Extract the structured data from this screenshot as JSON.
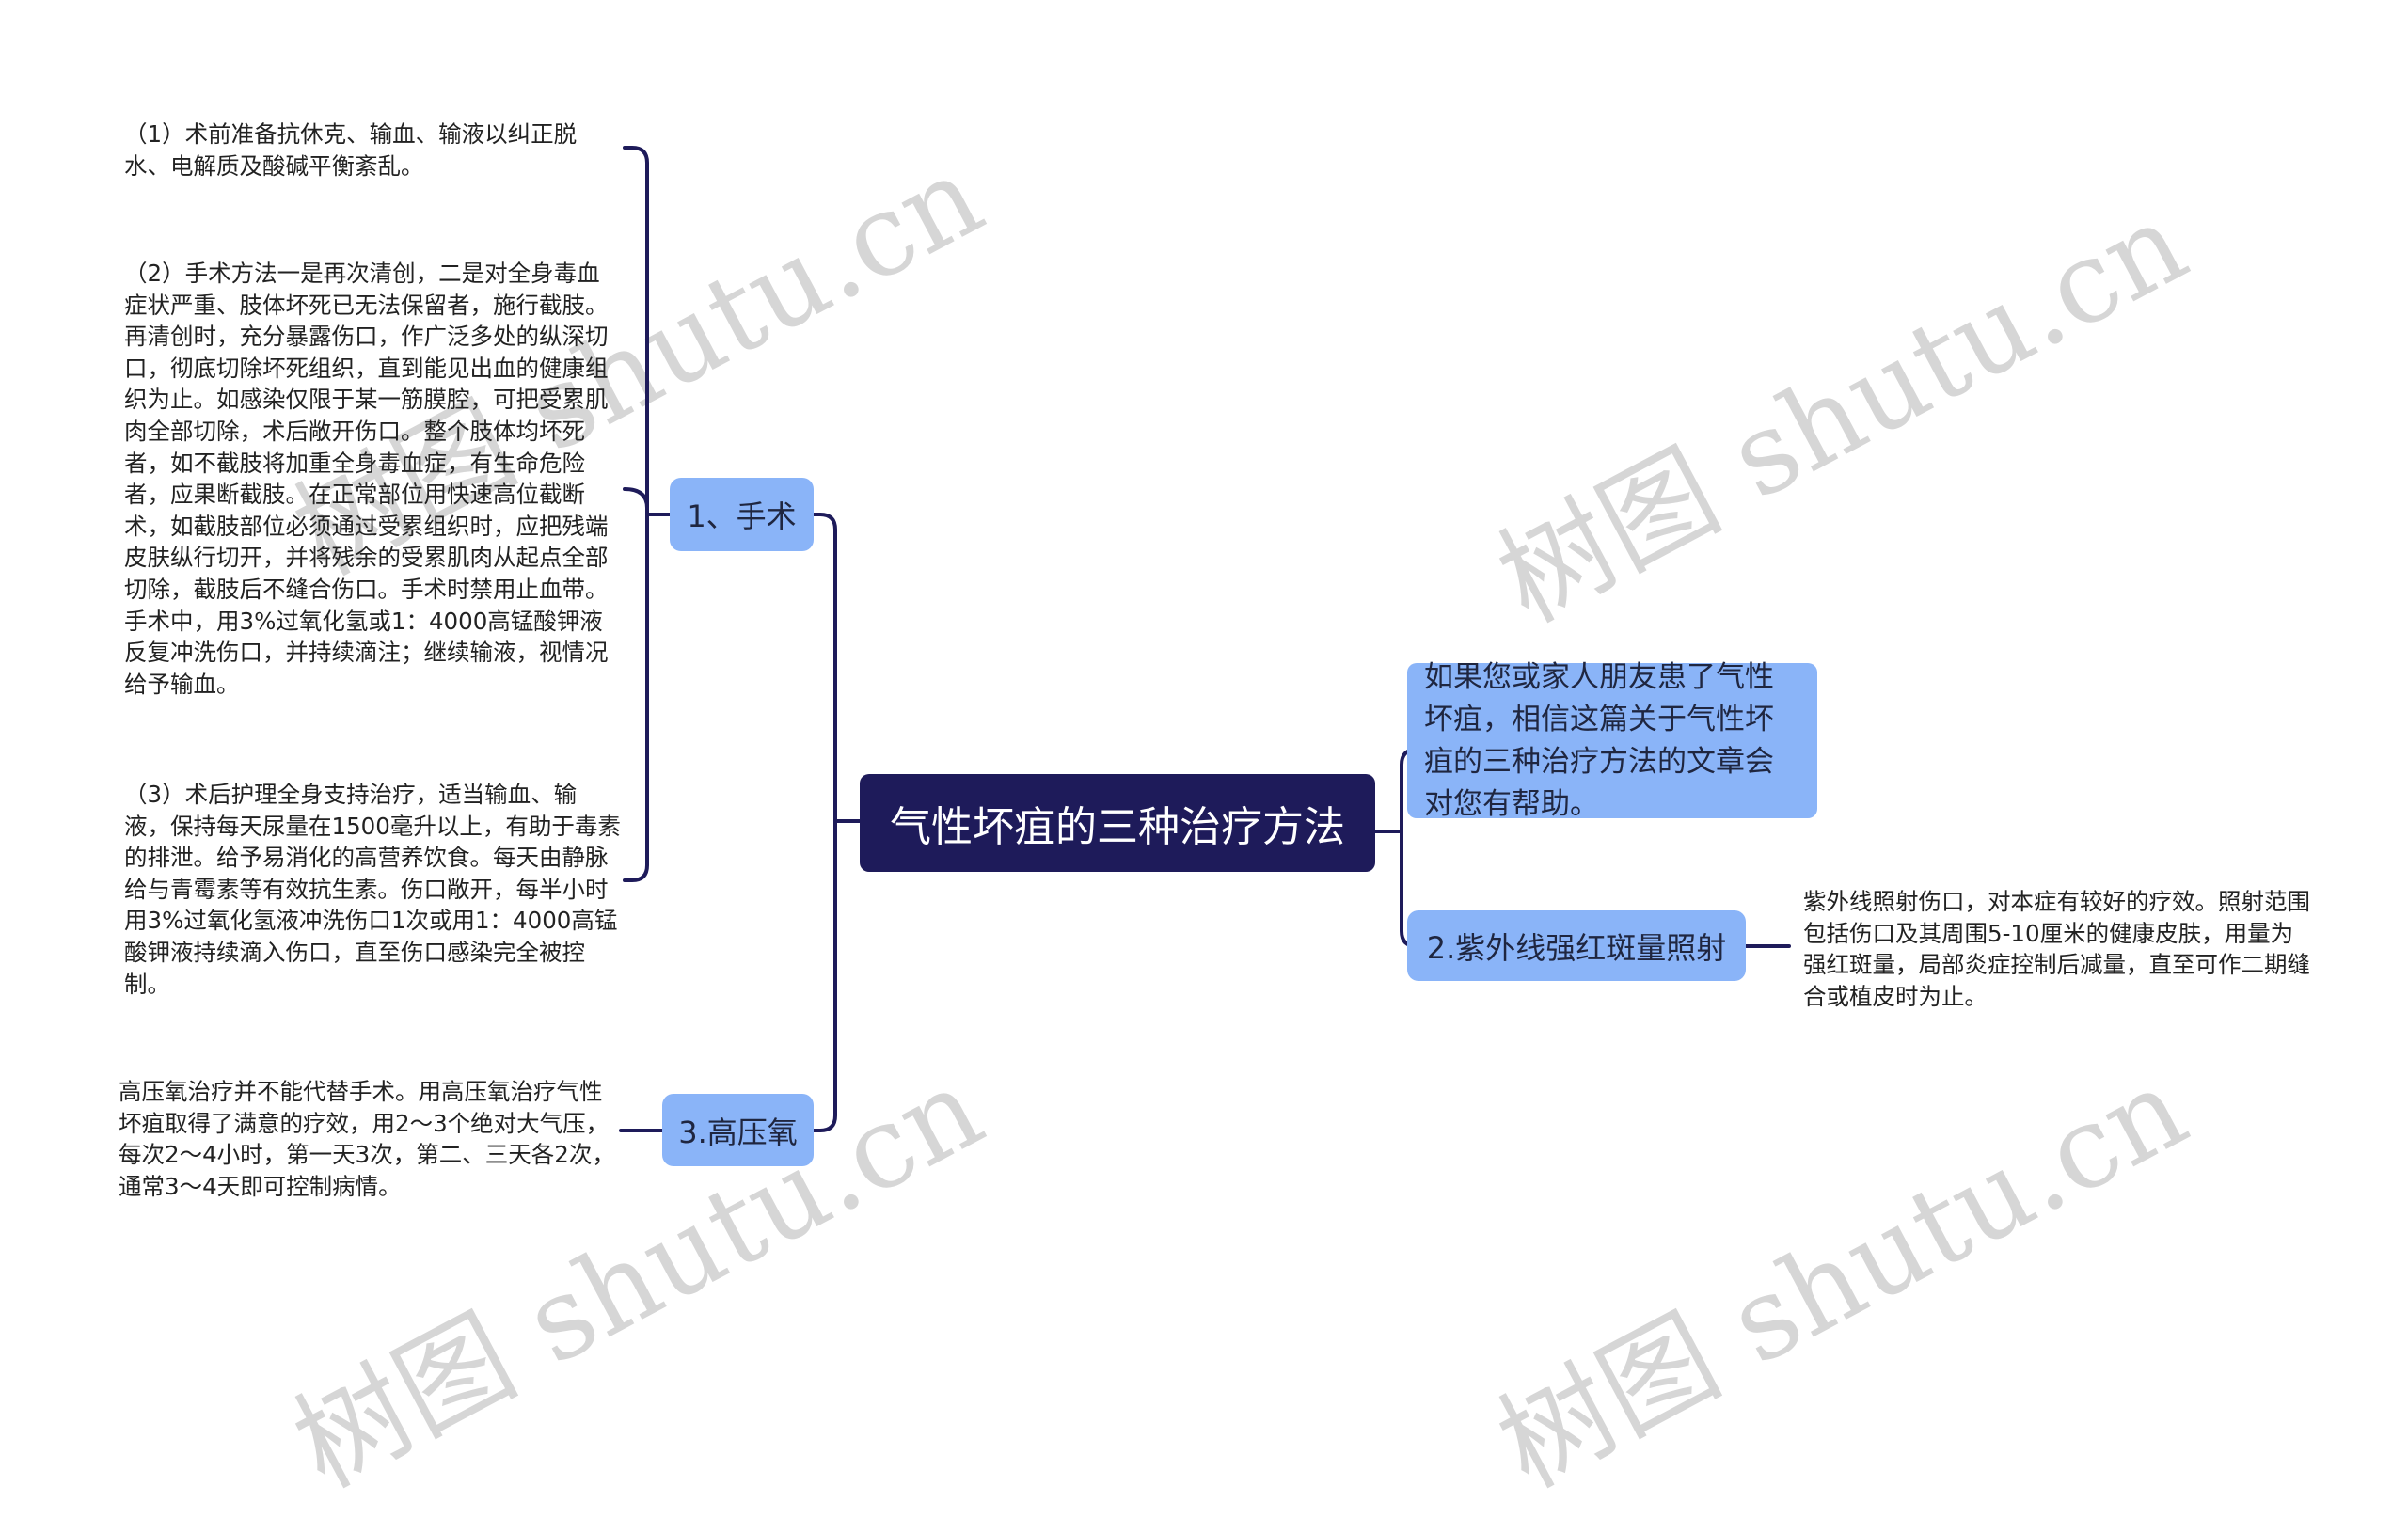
{
  "central": {
    "title": "气性坏疽的三种治疗方法"
  },
  "colors": {
    "central_bg": "#1e1b5a",
    "branch_bg": "#8ab4f8",
    "line": "#1e1b5a",
    "watermark": "#d6d6d6"
  },
  "branches": {
    "surgery": {
      "label": "1、手术",
      "details": [
        "（1）术前准备抗休克、输血、输液以纠正脱水、电解质及酸碱平衡紊乱。",
        "（2）手术方法一是再次清创，二是对全身毒血症状严重、肢体坏死已无法保留者，施行截肢。再清创时，充分暴露伤口，作广泛多处的纵深切口，彻底切除坏死组织，直到能见出血的健康组织为止。如感染仅限于某一筋膜腔，可把受累肌肉全部切除，术后敞开伤口。整个肢体均坏死者，如不截肢将加重全身毒血症，有生命危险者，应果断截肢。在正常部位用快速高位截断术，如截肢部位必须通过受累组织时，应把残端皮肤纵行切开，并将残余的受累肌肉从起点全部切除，截肢后不缝合伤口。手术时禁用止血带。手术中，用3%过氧化氢或1：4000高锰酸钾液反复冲洗伤口，并持续滴注；继续输液，视情况给予输血。",
        "（3）术后护理全身支持治疗，适当输血、输液，保持每天尿量在1500毫升以上，有助于毒素的排泄。给予易消化的高营养饮食。每天由静脉给与青霉素等有效抗生素。伤口敞开，每半小时用3%过氧化氢液冲洗伤口1次或用1：4000高锰酸钾液持续滴入伤口，直至伤口感染完全被控制。"
      ]
    },
    "oxygen": {
      "label": "3.高压氧",
      "detail": "高压氧治疗并不能代替手术。用高压氧治疗气性坏疽取得了满意的疗效，用2～3个绝对大气压，每次2～4小时，第一天3次，第二、三天各2次，通常3～4天即可控制病情。"
    },
    "intro": {
      "text": "如果您或家人朋友患了气性坏疽，相信这篇关于气性坏疽的三种治疗方法的文章会对您有帮助。"
    },
    "uv": {
      "label": "2.紫外线强红斑量照射",
      "detail": "紫外线照射伤口，对本症有较好的疗效。照射范围包括伤口及其周围5-10厘米的健康皮肤，用量为强红斑量，局部炎症控制后减量，直至可作二期缝合或植皮时为止。"
    }
  },
  "watermark": {
    "text": "树图 shutu.cn"
  }
}
